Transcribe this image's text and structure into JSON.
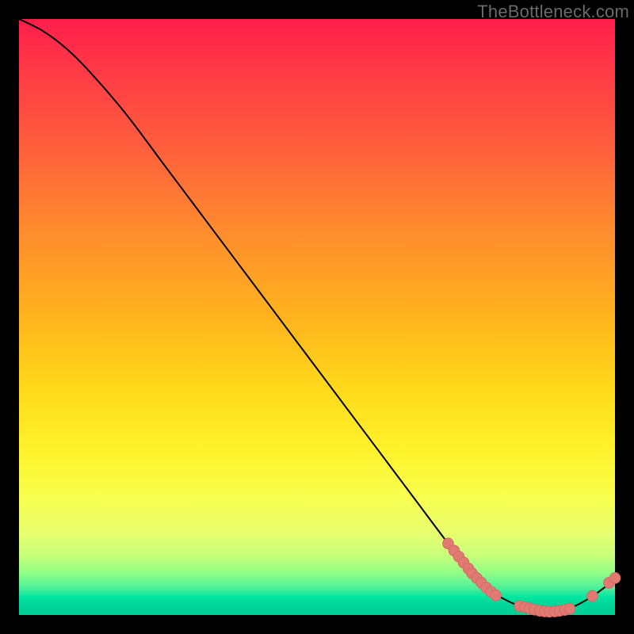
{
  "watermark": "TheBottleneck.com",
  "colors": {
    "curve_stroke": "#000000",
    "marker_fill": "#e27a74",
    "marker_stroke": "#d66b65"
  },
  "chart_data": {
    "type": "line",
    "title": "",
    "xlabel": "",
    "ylabel": "",
    "xlim": [
      0,
      100
    ],
    "ylim": [
      0,
      100
    ],
    "grid": false,
    "legend": false,
    "series": [
      {
        "name": "bottleneck-curve",
        "x": [
          0,
          4,
          8,
          12,
          18,
          24,
          30,
          36,
          42,
          48,
          54,
          60,
          66,
          72,
          76,
          80,
          84,
          88,
          92,
          96,
          100
        ],
        "values": [
          100,
          98,
          95,
          91,
          84,
          76,
          68,
          60,
          52,
          44,
          36,
          28,
          20,
          12,
          7,
          3.5,
          1.5,
          0.5,
          1.0,
          3.0,
          6.0
        ]
      }
    ],
    "markers": [
      {
        "name": "cluster-descent",
        "points": [
          {
            "x": 72.0,
            "y": 12.0
          },
          {
            "x": 73.0,
            "y": 10.8
          },
          {
            "x": 73.8,
            "y": 9.8
          },
          {
            "x": 74.6,
            "y": 8.8
          },
          {
            "x": 75.4,
            "y": 7.8
          },
          {
            "x": 76.0,
            "y": 7.0
          },
          {
            "x": 76.8,
            "y": 6.2
          },
          {
            "x": 77.6,
            "y": 5.4
          },
          {
            "x": 78.4,
            "y": 4.6
          },
          {
            "x": 79.2,
            "y": 3.9
          },
          {
            "x": 80.0,
            "y": 3.3
          }
        ]
      },
      {
        "name": "cluster-floor",
        "points": [
          {
            "x": 84.0,
            "y": 1.5
          },
          {
            "x": 84.9,
            "y": 1.3
          },
          {
            "x": 85.7,
            "y": 1.1
          },
          {
            "x": 86.5,
            "y": 0.9
          },
          {
            "x": 87.4,
            "y": 0.7
          },
          {
            "x": 88.2,
            "y": 0.6
          },
          {
            "x": 89.0,
            "y": 0.55
          },
          {
            "x": 89.9,
            "y": 0.6
          },
          {
            "x": 90.7,
            "y": 0.7
          },
          {
            "x": 91.6,
            "y": 0.85
          },
          {
            "x": 92.4,
            "y": 1.05
          }
        ]
      },
      {
        "name": "cluster-rise",
        "points": [
          {
            "x": 96.2,
            "y": 3.2
          },
          {
            "x": 99.0,
            "y": 5.4
          },
          {
            "x": 100.0,
            "y": 6.2
          }
        ]
      }
    ]
  }
}
